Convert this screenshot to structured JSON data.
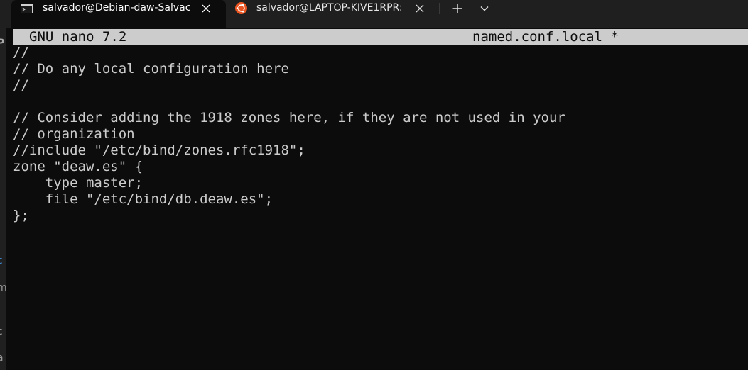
{
  "tabs": [
    {
      "title": "salvador@Debian-daw-Salvac",
      "icon": "terminal-icon",
      "active": true
    },
    {
      "title": "salvador@LAPTOP-KIVE1RPR: ·",
      "icon": "ubuntu-icon",
      "active": false
    }
  ],
  "icons": {
    "close": "close-icon",
    "new_tab": "plus-icon",
    "dropdown": "chevron-down-icon"
  },
  "left_strip": {
    "fragments": [
      "P",
      "c",
      "m",
      "c",
      "a"
    ]
  },
  "nano": {
    "version": "GNU nano 7.2",
    "filename": "named.conf.local *"
  },
  "editor": {
    "lines": [
      "//",
      "// Do any local configuration here",
      "//",
      "",
      "// Consider adding the 1918 zones here, if they are not used in your",
      "// organization",
      "//include \"/etc/bind/zones.rfc1918\";",
      "zone \"deaw.es\" {",
      "    type master;",
      "    file \"/etc/bind/db.deaw.es\";",
      "};"
    ]
  },
  "colors": {
    "tabbar_bg": "#1f1f1f",
    "terminal_bg": "#0c0c0c",
    "header_bg": "#cccccc",
    "text": "#cccccc",
    "ubuntu_orange": "#e95420"
  }
}
